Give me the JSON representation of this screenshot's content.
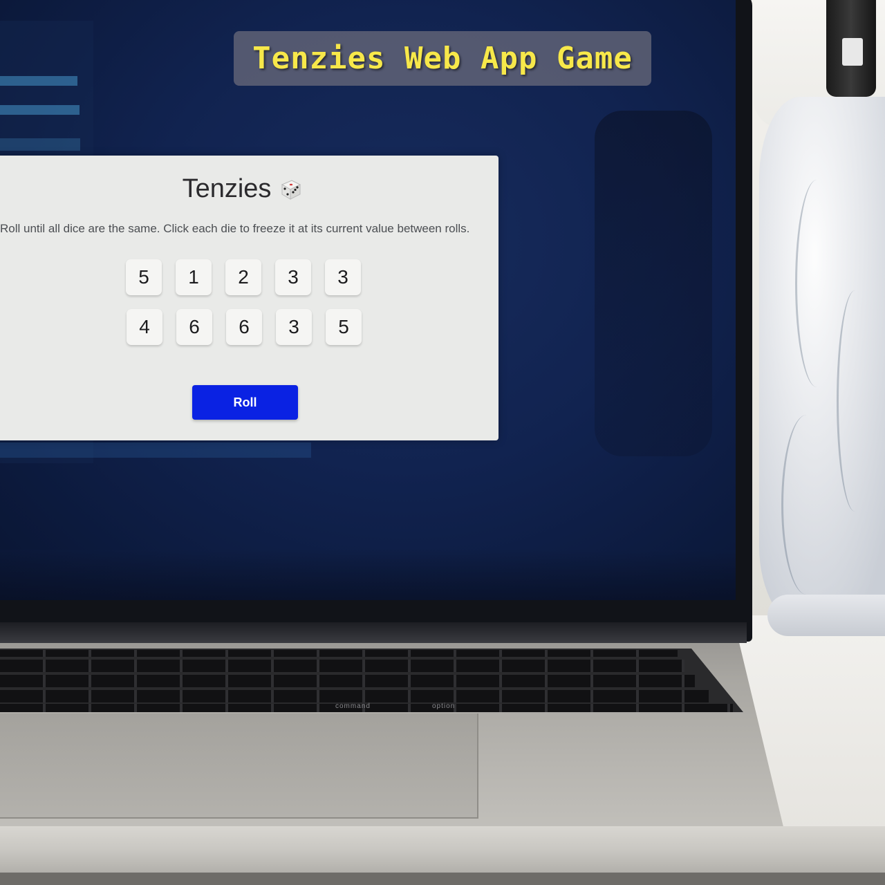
{
  "caption": {
    "text": "Tenzies Web App Game"
  },
  "game": {
    "title": "Tenzies",
    "instructions": "Roll until all dice are the same. Click each die to freeze it at its current value between rolls.",
    "dice": [
      "5",
      "1",
      "2",
      "3",
      "3",
      "4",
      "6",
      "6",
      "3",
      "5"
    ],
    "roll_label": "Roll"
  },
  "keyboard": {
    "command_label": "command",
    "option_label": "option"
  },
  "colors": {
    "roll_button": "#0a22e3",
    "card_background": "#e9eae8",
    "caption_text": "#f7e84a"
  }
}
